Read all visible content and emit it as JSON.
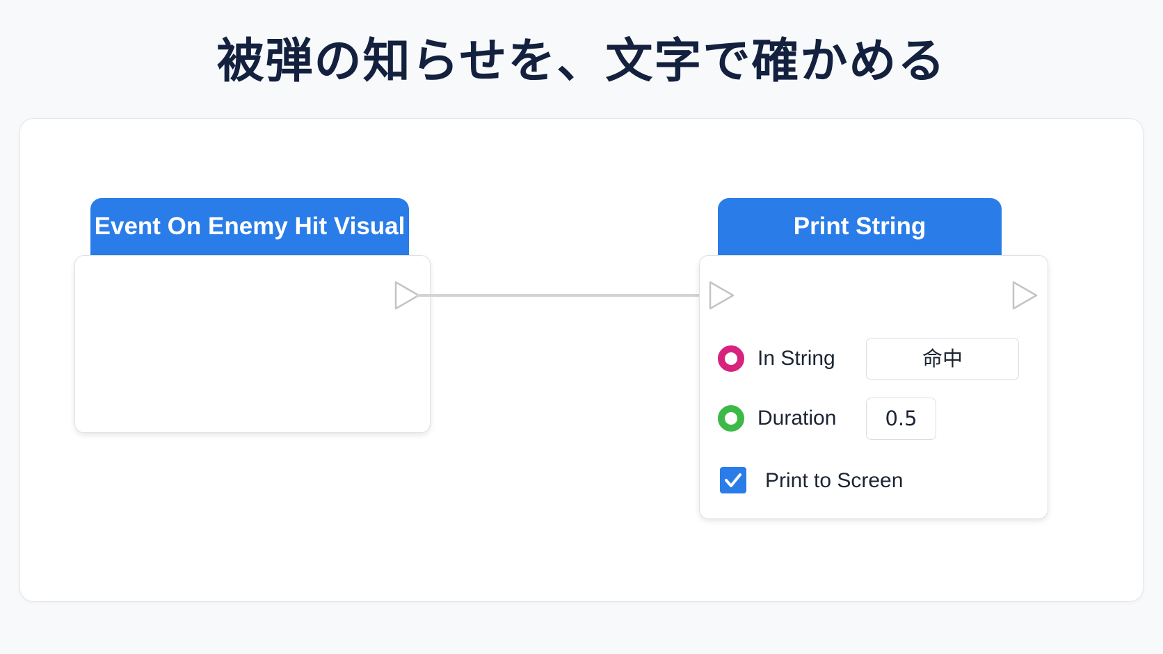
{
  "title": "被弾の知らせを、文字で確かめる",
  "colors": {
    "header": "#2a7de9",
    "string_pin": "#d8237e",
    "float_pin": "#3cb946",
    "checkbox": "#2a7de9",
    "wire": "#d3d3d3"
  },
  "event_node": {
    "title": "Event On Enemy Hit Visual",
    "exec_out_icon": "exec-pin-triangle"
  },
  "print_node": {
    "title": "Print String",
    "exec_in_icon": "exec-pin-triangle",
    "exec_out_icon": "exec-pin-triangle",
    "in_string": {
      "label": "In String",
      "value": "命中",
      "pin_icon": "string-pin-circle"
    },
    "duration": {
      "label": "Duration",
      "value": "0.5",
      "pin_icon": "float-pin-circle"
    },
    "print_to_screen": {
      "label": "Print to Screen",
      "checked": true
    }
  }
}
